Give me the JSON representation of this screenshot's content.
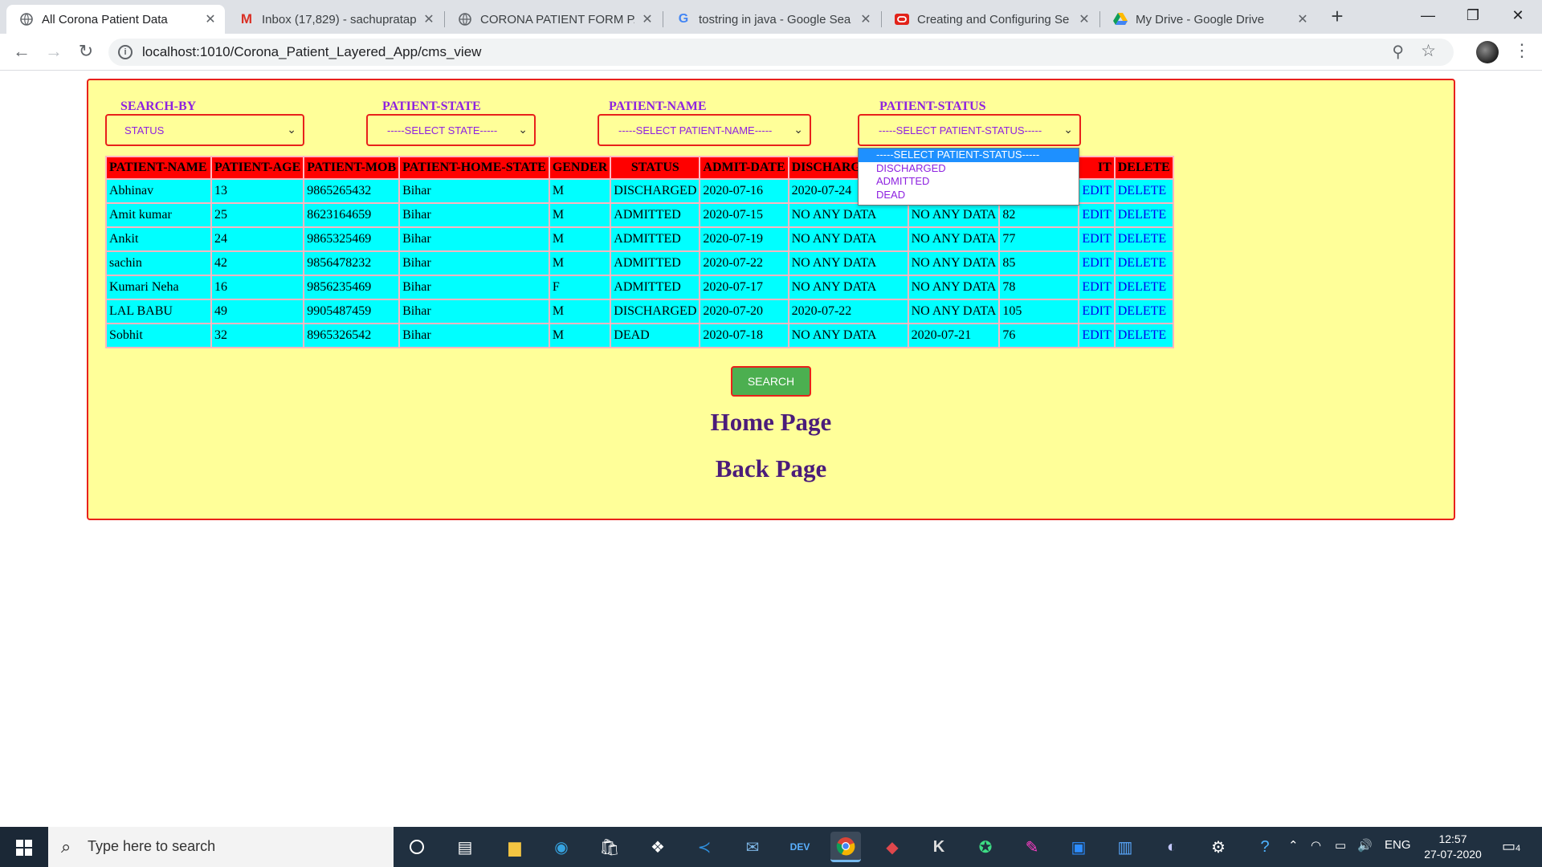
{
  "browser": {
    "tabs": [
      {
        "title": "All Corona Patient Data",
        "icon": "globe-icon",
        "active": true
      },
      {
        "title": "Inbox (17,829) - sachupratap",
        "icon": "gmail-icon",
        "active": false
      },
      {
        "title": "CORONA PATIENT FORM PAGE",
        "icon": "globe-icon",
        "active": false
      },
      {
        "title": "tostring in java - Google Sea",
        "icon": "google-icon",
        "active": false
      },
      {
        "title": "Creating and Configuring Se",
        "icon": "oracle-icon",
        "active": false
      },
      {
        "title": "My Drive - Google Drive",
        "icon": "drive-icon",
        "active": false
      }
    ],
    "url": "localhost:1010/Corona_Patient_Layered_App/cms_view"
  },
  "filters": {
    "search_by": {
      "label": "SEARCH-BY",
      "value": "STATUS"
    },
    "patient_state": {
      "label": "PATIENT-STATE",
      "value": "-----SELECT STATE-----"
    },
    "patient_name": {
      "label": "PATIENT-NAME",
      "value": "-----SELECT PATIENT-NAME-----"
    },
    "patient_status": {
      "label": "PATIENT-STATUS",
      "value": "-----SELECT PATIENT-STATUS-----",
      "options": [
        "-----SELECT PATIENT-STATUS-----",
        "DISCHARGED",
        "ADMITTED",
        "DEAD"
      ]
    }
  },
  "table": {
    "headers": [
      "PATIENT-NAME",
      "PATIENT-AGE",
      "PATIENT-MOB",
      "PATIENT-HOME-STATE",
      "GENDER",
      "STATUS",
      "ADMIT-DATE",
      "DISCHARGE-",
      "",
      "",
      "IT",
      "DELETE"
    ],
    "rows": [
      [
        "Abhinav",
        "13",
        "9865265432",
        "Bihar",
        "M",
        "DISCHARGED",
        "2020-07-16",
        "2020-07-24",
        "",
        "",
        "EDIT",
        "DELETE"
      ],
      [
        "Amit kumar",
        "25",
        "8623164659",
        "Bihar",
        "M",
        "ADMITTED",
        "2020-07-15",
        "NO ANY DATA",
        "NO ANY DATA",
        "82",
        "EDIT",
        "DELETE"
      ],
      [
        "Ankit",
        "24",
        "9865325469",
        "Bihar",
        "M",
        "ADMITTED",
        "2020-07-19",
        "NO ANY DATA",
        "NO ANY DATA",
        "77",
        "EDIT",
        "DELETE"
      ],
      [
        "sachin",
        "42",
        "9856478232",
        "Bihar",
        "M",
        "ADMITTED",
        "2020-07-22",
        "NO ANY DATA",
        "NO ANY DATA",
        "85",
        "EDIT",
        "DELETE"
      ],
      [
        "Kumari Neha",
        "16",
        "9856235469",
        "Bihar",
        "F",
        "ADMITTED",
        "2020-07-17",
        "NO ANY DATA",
        "NO ANY DATA",
        "78",
        "EDIT",
        "DELETE"
      ],
      [
        "LAL BABU",
        "49",
        "9905487459",
        "Bihar",
        "M",
        "DISCHARGED",
        "2020-07-20",
        "2020-07-22",
        "NO ANY DATA",
        "105",
        "EDIT",
        "DELETE"
      ],
      [
        "Sobhit",
        "32",
        "8965326542",
        "Bihar",
        "M",
        "DEAD",
        "2020-07-18",
        "NO ANY DATA",
        "2020-07-21",
        "76",
        "EDIT",
        "DELETE"
      ]
    ]
  },
  "actions": {
    "search": "SEARCH",
    "home": "Home Page",
    "back": "Back Page"
  },
  "taskbar": {
    "search_placeholder": "Type here to search",
    "language": "ENG",
    "time": "12:57",
    "date": "27-07-2020",
    "notifications": "4"
  },
  "colors": {
    "panel_bg": "#ffff99",
    "accent_border": "#e8211b",
    "label_purple": "#8e22e0",
    "header_red": "#ff0000",
    "cell_cyan": "#00ffff",
    "button_green": "#4caf50"
  }
}
